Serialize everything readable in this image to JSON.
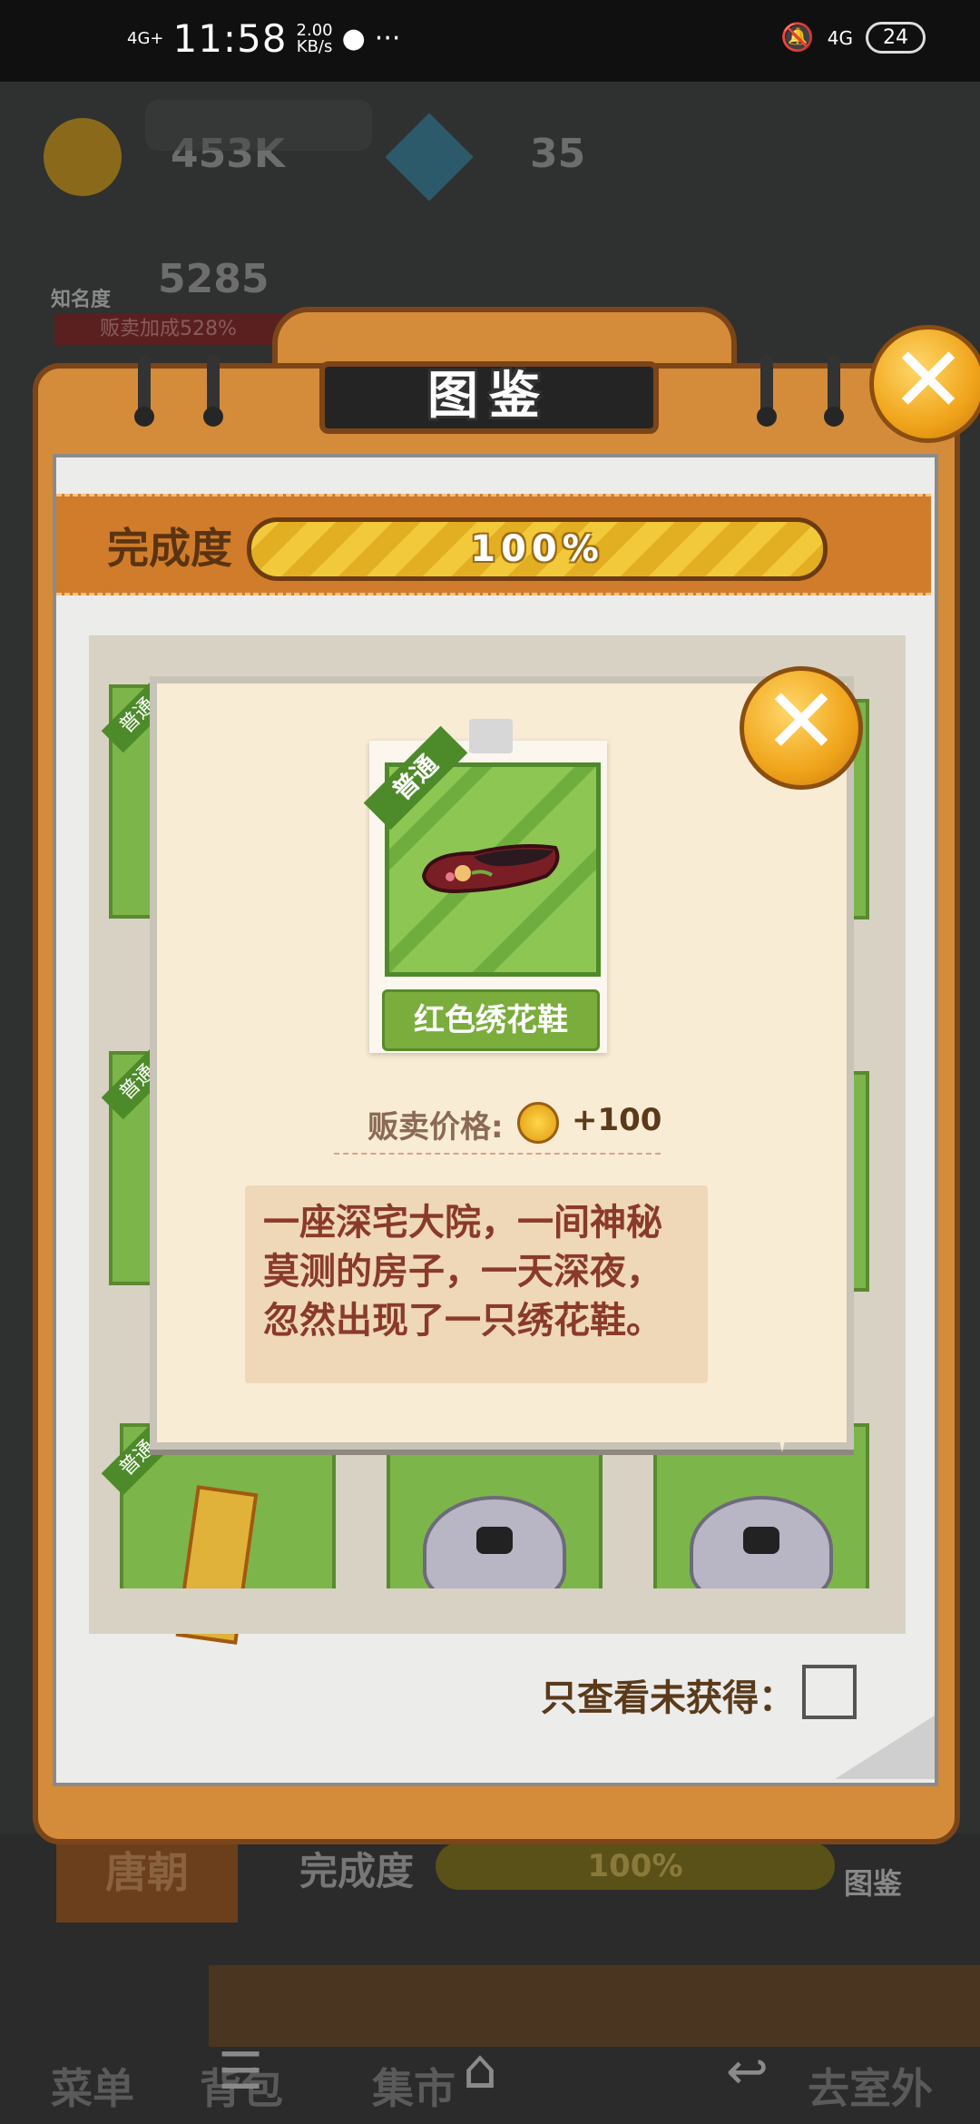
{
  "status_bar": {
    "signal": "4G+",
    "time": "11:58",
    "speed_value": "2.00",
    "speed_unit": "KB/s",
    "more": "···",
    "network_right": "4G",
    "battery": "24"
  },
  "hud": {
    "coins": "453K",
    "gems": "35",
    "fame_label": "知名度",
    "fame_value": "5285",
    "sale_bonus": "贩卖加成528%"
  },
  "panel": {
    "title": "图鉴",
    "progress_label": "完成度",
    "progress_text": "100%",
    "progress_percent": 100,
    "filter_label": "只查看未获得：",
    "filter_checked": false
  },
  "grid": {
    "badge": "普通"
  },
  "popup": {
    "rarity_badge": "普通",
    "item_name": "红色绣花鞋",
    "price_label": "贩卖价格:",
    "price_value": "+100",
    "description": "一座深宅大院，一间神秘莫测的房子，一天深夜，忽然出现了一只绣花鞋。",
    "close_icon": "close-icon"
  },
  "background_screen": {
    "era_tab": "唐朝",
    "progress_label": "完成度",
    "progress_text": "100%",
    "tujian_label": "图鉴",
    "nav_items": [
      "菜单",
      "背包",
      "集市",
      "去室外"
    ]
  },
  "colors": {
    "panel_orange": "#d58c3a",
    "panel_border": "#7c4519",
    "progress_yellow": "#f2c93a",
    "card_green": "#7cb54a",
    "popup_bg": "#f8ecd5",
    "desc_text": "#8a3a2a"
  }
}
